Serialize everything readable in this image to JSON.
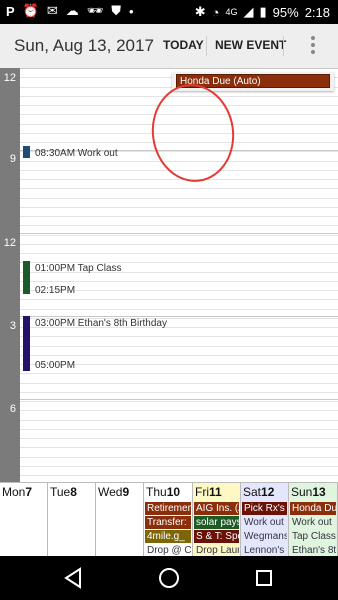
{
  "status": {
    "battery": "95%",
    "time": "2:18",
    "network": "4G"
  },
  "appbar": {
    "title": "Sun, Aug 13, 2017",
    "today_label": "TODAY",
    "new_event_label": "NEW EVENT"
  },
  "hours": [
    "12",
    "9",
    "12",
    "3",
    "6"
  ],
  "allday_event": "Honda Due (Auto)",
  "events": [
    {
      "start": "08:30AM Work out",
      "end": "",
      "color": "#1f4d7a"
    },
    {
      "start": "01:00PM Tap Class",
      "end": "02:15PM",
      "color": "#1d5a2a"
    },
    {
      "start": "03:00PM Ethan's 8th Birthday",
      "end": "05:00PM",
      "color": "#25106b"
    }
  ],
  "week": [
    {
      "dow": "Mon",
      "num": "7",
      "bg": "#ffffff",
      "chips": []
    },
    {
      "dow": "Tue",
      "num": "8",
      "bg": "#ffffff",
      "chips": []
    },
    {
      "dow": "Wed",
      "num": "9",
      "bg": "#ffffff",
      "chips": []
    },
    {
      "dow": "Thu",
      "num": "10",
      "bg": "#ffffff",
      "chips": [
        {
          "text": "Retiremen",
          "style": "rust"
        },
        {
          "text": "Transfer:",
          "style": "rust"
        },
        {
          "text": "4mile.g_",
          "style": "olive"
        },
        {
          "text": "Drop @ C",
          "style": "plain"
        }
      ]
    },
    {
      "dow": "Fri",
      "num": "11",
      "bg": "#fdf8c4",
      "chips": [
        {
          "text": "AIG Ins. (A",
          "style": "rust"
        },
        {
          "text": "solar pays",
          "style": "green"
        },
        {
          "text": "S & T: Spo",
          "style": "maroon"
        },
        {
          "text": "Drop Laur",
          "style": "plain"
        }
      ]
    },
    {
      "dow": "Sat",
      "num": "12",
      "bg": "#e4e7fb",
      "chips": [
        {
          "text": "Pick Rx's",
          "style": "maroon"
        },
        {
          "text": "Work out",
          "style": "plain"
        },
        {
          "text": "Wegmans",
          "style": "plain"
        },
        {
          "text": "Lennon's",
          "style": "plain"
        }
      ]
    },
    {
      "dow": "Sun",
      "num": "13",
      "bg": "#dff5dd",
      "chips": [
        {
          "text": "Honda Du",
          "style": "rust"
        },
        {
          "text": "Work out",
          "style": "plain"
        },
        {
          "text": "Tap Class",
          "style": "plain"
        },
        {
          "text": "Ethan's 8t",
          "style": "plain"
        }
      ]
    }
  ]
}
